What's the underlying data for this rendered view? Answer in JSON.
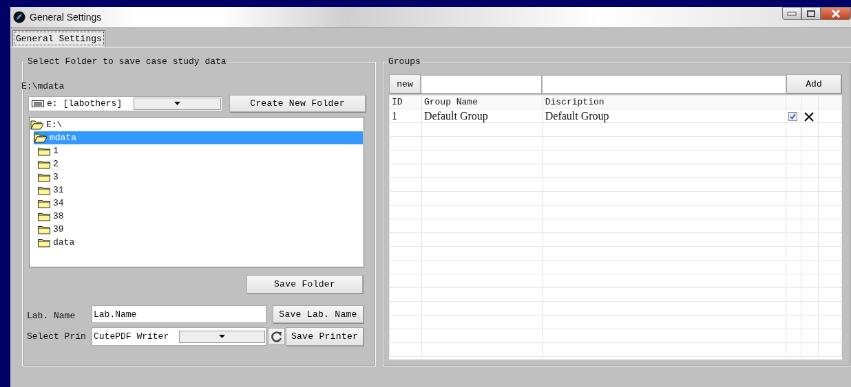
{
  "window": {
    "title": "General Settings"
  },
  "tabs": [
    {
      "label": "General Settings",
      "selected": true
    }
  ],
  "folder_group": {
    "title": "Select Folder to save case study data",
    "path": "E:\\mdata",
    "drive": "e: [labothers]",
    "create_button": "Create New Folder",
    "tree": [
      {
        "label": "E:\\",
        "expanded": true,
        "selected": false,
        "children": [
          {
            "label": "mdata",
            "expanded": true,
            "selected": true,
            "children": [
              {
                "label": "1",
                "expanded": false,
                "selected": false
              },
              {
                "label": "2",
                "expanded": false,
                "selected": false
              },
              {
                "label": "3",
                "expanded": false,
                "selected": false
              },
              {
                "label": "31",
                "expanded": false,
                "selected": false
              },
              {
                "label": "34",
                "expanded": false,
                "selected": false
              },
              {
                "label": "38",
                "expanded": false,
                "selected": false
              },
              {
                "label": "39",
                "expanded": false,
                "selected": false
              },
              {
                "label": "data",
                "expanded": false,
                "selected": false
              }
            ]
          }
        ]
      }
    ],
    "save_folder_button": "Save Folder",
    "lab_name_label": "Lab. Name",
    "lab_name_value": "Lab.Name",
    "save_lab_button": "Save Lab. Name",
    "printer_label": "Select Prin",
    "printer_value": "CutePDF Writer",
    "save_printer_button": "Save Printer"
  },
  "groups": {
    "title": "Groups",
    "new_button": "new",
    "add_button": "Add",
    "columns": [
      "ID",
      "Group Name",
      "Discription"
    ],
    "rows": [
      {
        "id": "1",
        "name": "Default Group",
        "description": "Default Group",
        "checked": true
      }
    ]
  }
}
